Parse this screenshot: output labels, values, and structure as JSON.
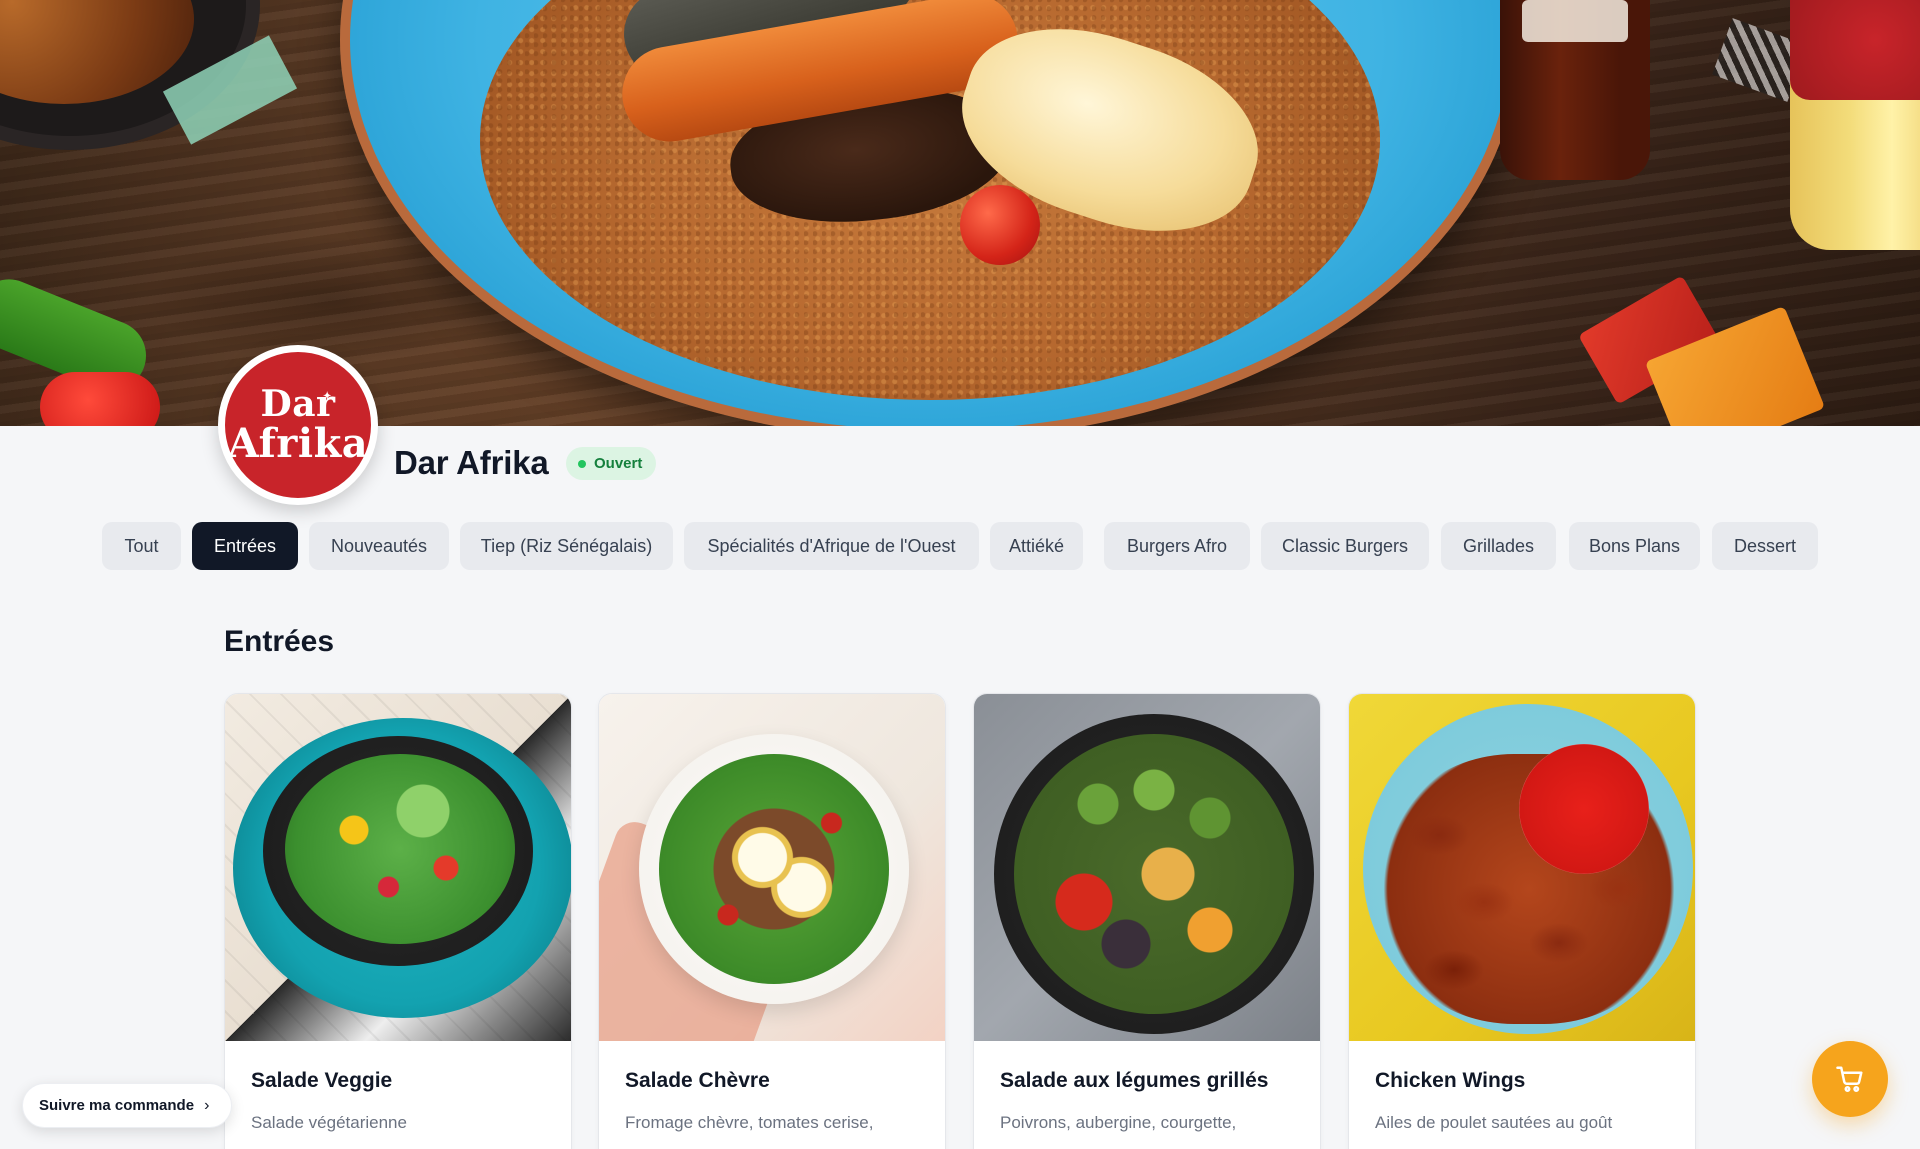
{
  "restaurant": {
    "logo_line1": "Dar",
    "logo_line2": "Afrika",
    "name": "Dar Afrika",
    "status": "Ouvert"
  },
  "categories": [
    {
      "label": "Tout",
      "active": false
    },
    {
      "label": "Entrées",
      "active": true
    },
    {
      "label": "Nouveautés",
      "active": false
    },
    {
      "label": "Tiep (Riz Sénégalais)",
      "active": false
    },
    {
      "label": "Spécialités d'Afrique de l'Ouest",
      "active": false
    },
    {
      "label": "Attiéké",
      "active": false
    },
    {
      "label": "Burgers Afro",
      "active": false
    },
    {
      "label": "Classic Burgers",
      "active": false
    },
    {
      "label": "Grillades",
      "active": false
    },
    {
      "label": "Bons Plans",
      "active": false
    },
    {
      "label": "Dessert",
      "active": false
    }
  ],
  "section": {
    "title": "Entrées",
    "items": [
      {
        "name": "Salade Veggie",
        "description": "Salade végétarienne"
      },
      {
        "name": "Salade Chèvre",
        "description": "Fromage chèvre, tomates cerise,"
      },
      {
        "name": "Salade aux légumes grillés",
        "description": "Poivrons, aubergine, courgette,"
      },
      {
        "name": "Chicken Wings",
        "description": "Ailes de poulet sautées au goût"
      }
    ]
  },
  "floating": {
    "track_order_label": "Suivre ma commande",
    "cart_icon": "cart-icon"
  },
  "colors": {
    "brand_red": "#c8242a",
    "status_green": "#15803d",
    "status_bg": "#dcf4e3",
    "active_tab": "#111827",
    "cart_orange": "#f6a41c"
  }
}
